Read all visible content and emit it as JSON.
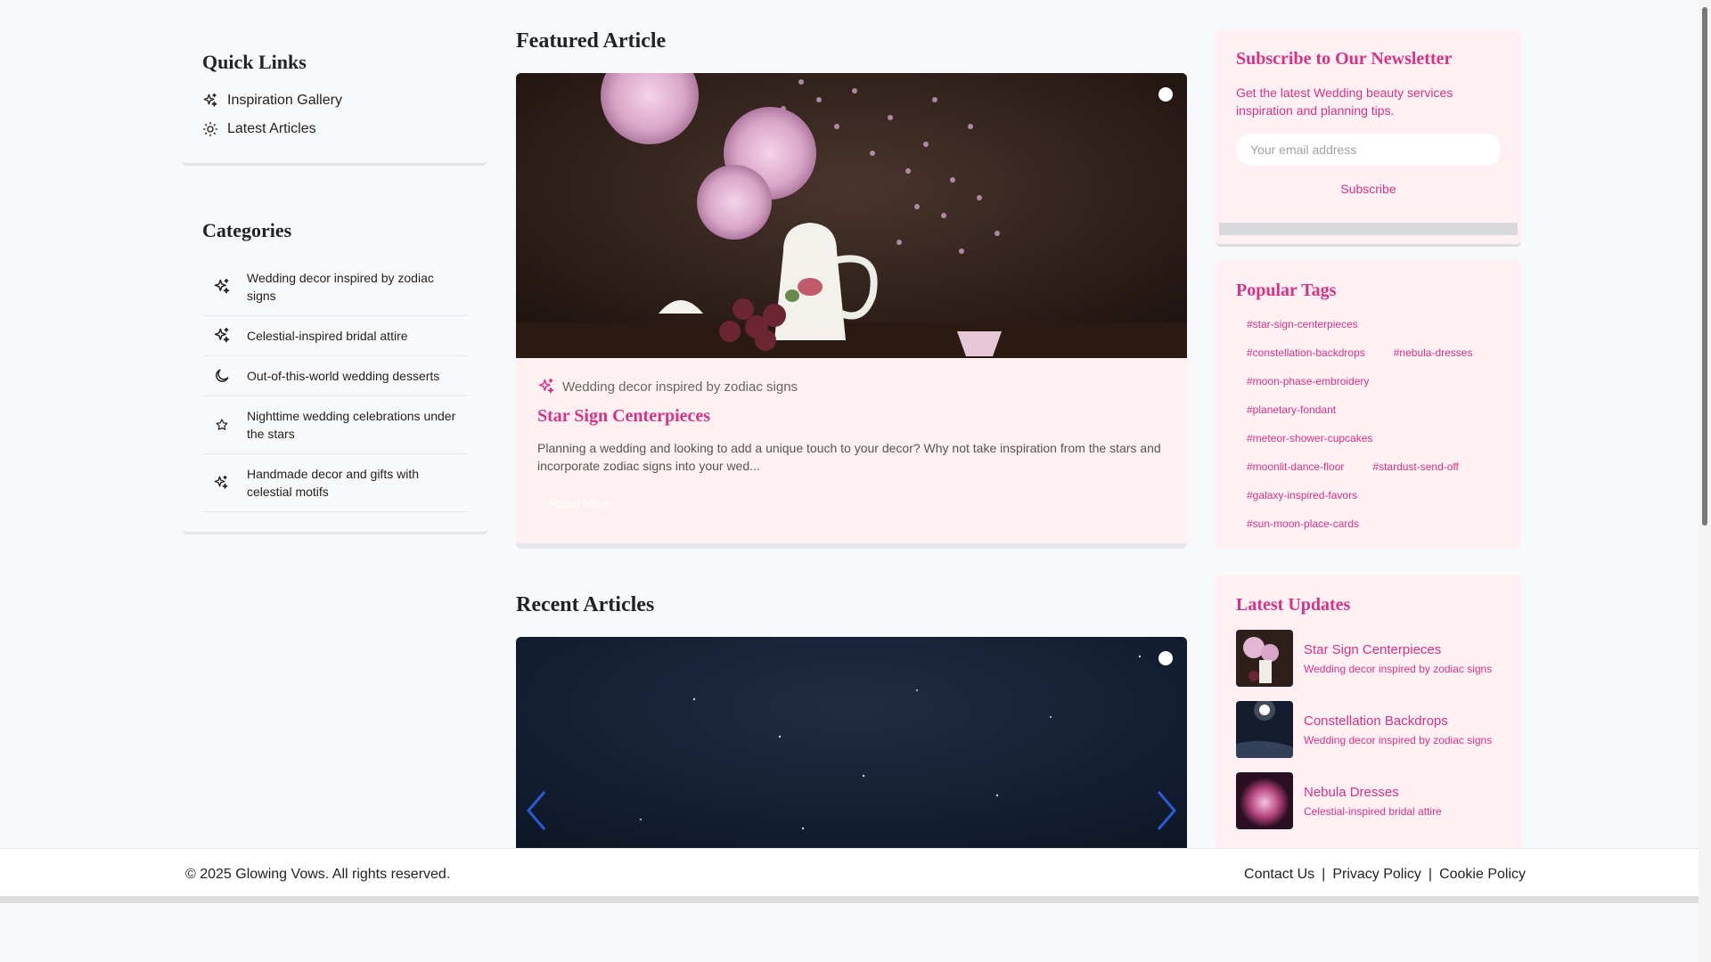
{
  "quick_links": {
    "title": "Quick Links",
    "items": [
      {
        "label": "Inspiration Gallery",
        "icon": "sparkles-icon"
      },
      {
        "label": "Latest Articles",
        "icon": "sun-icon"
      }
    ]
  },
  "categories": {
    "title": "Categories",
    "items": [
      {
        "label": "Wedding decor inspired by zodiac signs",
        "icon": "sparkles-icon"
      },
      {
        "label": "Celestial-inspired bridal attire",
        "icon": "sparkles-icon"
      },
      {
        "label": "Out-of-this-world wedding desserts",
        "icon": "moon-icon"
      },
      {
        "label": "Nighttime wedding celebrations under the stars",
        "icon": "star-icon"
      },
      {
        "label": "Handmade decor and gifts with celestial motifs",
        "icon": "sparkles-icon"
      }
    ]
  },
  "featured": {
    "section_title": "Featured Article",
    "category": "Wedding decor inspired by zodiac signs",
    "title": "Star Sign Centerpieces",
    "description": "Planning a wedding and looking to add a unique touch to your decor? Why not take inspiration from the stars and incorporate zodiac signs into your wed...",
    "read_more": "Read More"
  },
  "recent": {
    "section_title": "Recent Articles"
  },
  "newsletter": {
    "title": "Subscribe to Our Newsletter",
    "description": "Get the latest Wedding beauty services inspiration and planning tips.",
    "placeholder": "Your email address",
    "button": "Subscribe"
  },
  "tags": {
    "title": "Popular Tags",
    "rows": [
      [
        "#star-sign-centerpieces"
      ],
      [
        "#constellation-backdrops",
        "#nebula-dresses"
      ],
      [
        "#moon-phase-embroidery"
      ],
      [
        "#planetary-fondant"
      ],
      [
        "#meteor-shower-cupcakes"
      ],
      [
        "#moonlit-dance-floor",
        "#stardust-send-off"
      ],
      [
        "#galaxy-inspired-favors"
      ],
      [
        "#sun-moon-place-cards"
      ]
    ]
  },
  "updates": {
    "title": "Latest Updates",
    "items": [
      {
        "title": "Star Sign Centerpieces",
        "subtitle": "Wedding decor inspired by zodiac signs"
      },
      {
        "title": "Constellation Backdrops",
        "subtitle": "Wedding decor inspired by zodiac signs"
      },
      {
        "title": "Nebula Dresses",
        "subtitle": "Celestial-inspired bridal attire"
      }
    ]
  },
  "footer": {
    "copyright": "© 2025 Glowing Vows. All rights reserved.",
    "links": [
      "Contact Us",
      "Privacy Policy",
      "Cookie Policy"
    ],
    "separator": "|"
  },
  "colors": {
    "accent": "#d63384",
    "card_bg": "#fff0f3",
    "page_bg": "#f8f9fb"
  }
}
